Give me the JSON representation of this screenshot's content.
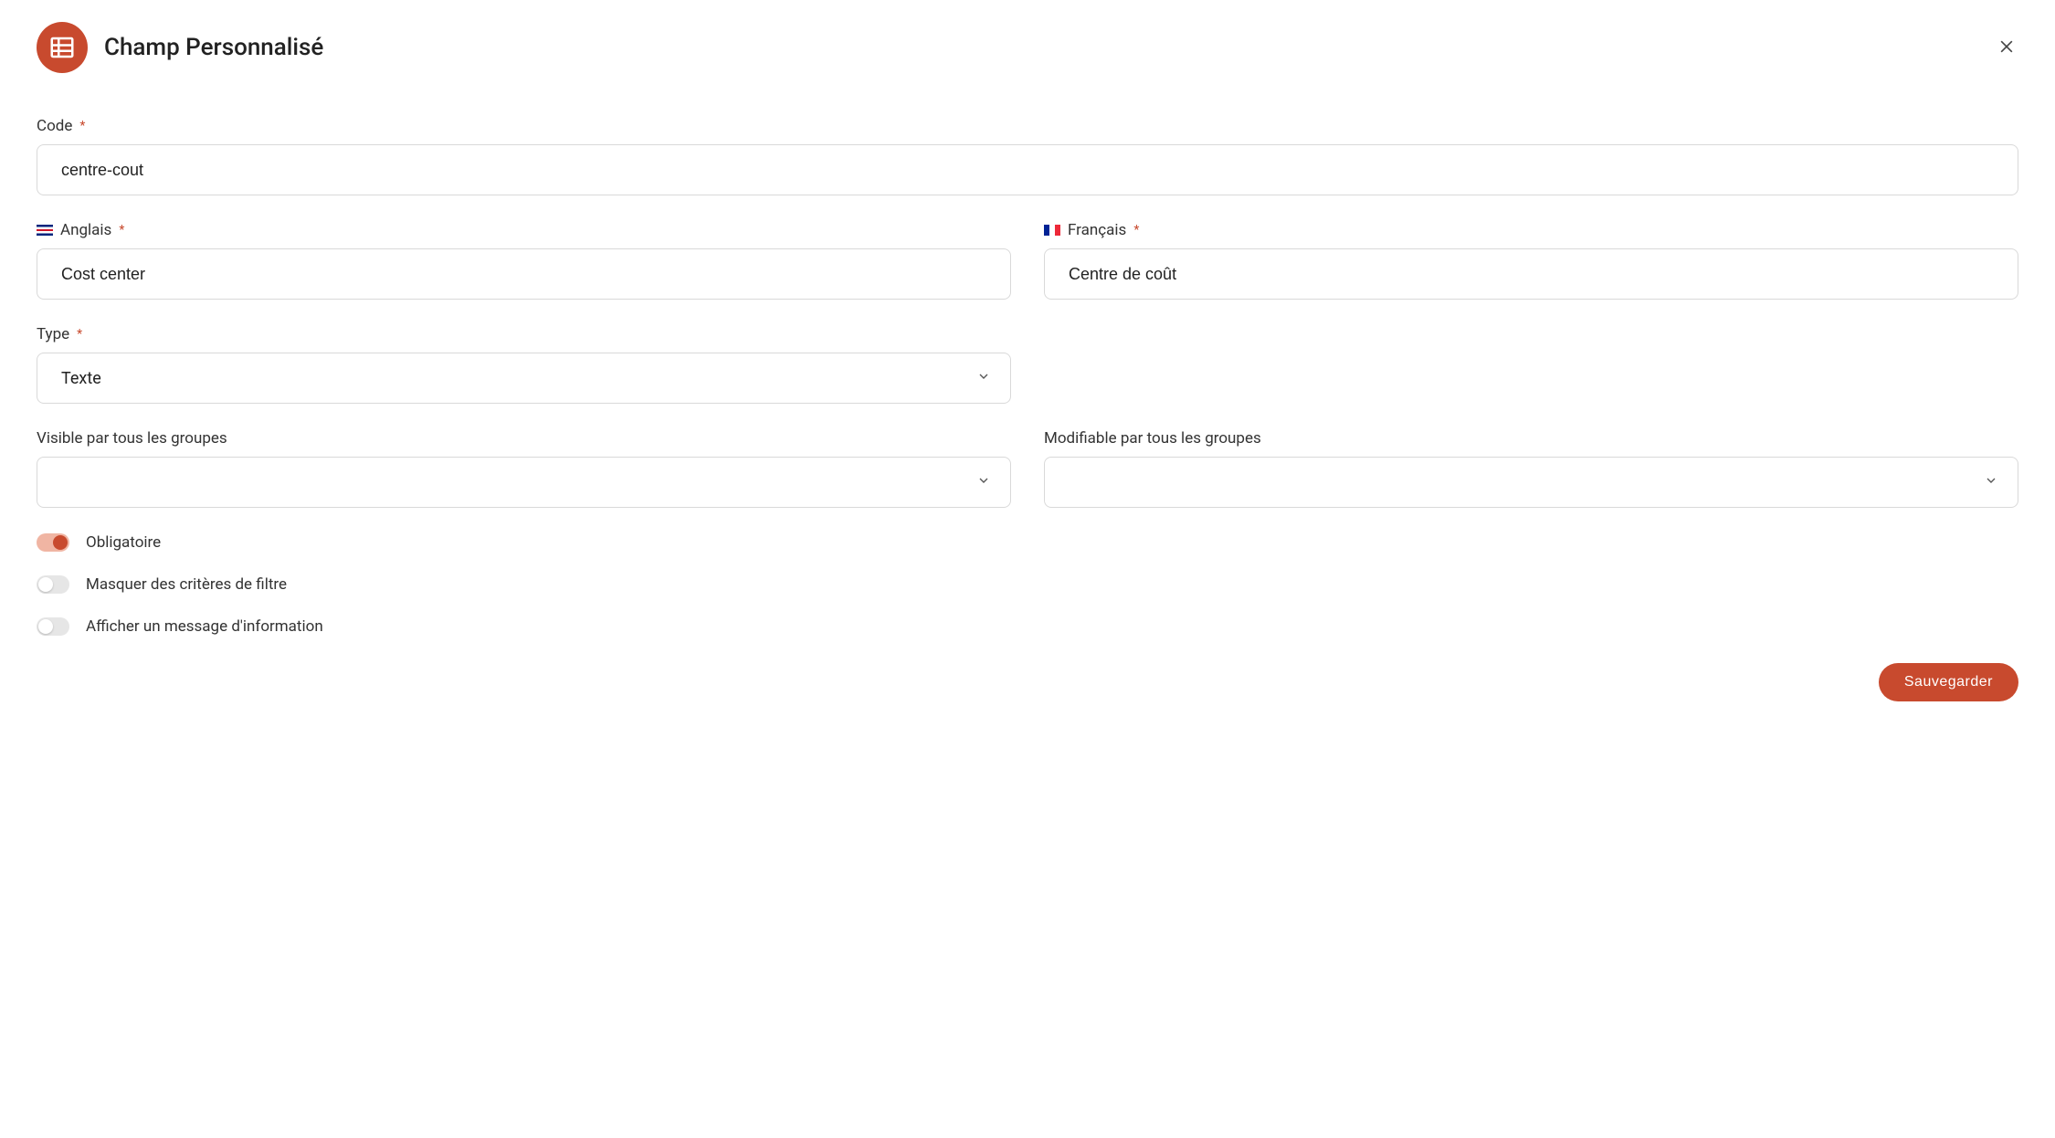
{
  "header": {
    "title": "Champ Personnalisé"
  },
  "form": {
    "code": {
      "label": "Code",
      "value": "centre-cout"
    },
    "english": {
      "label": "Anglais",
      "value": "Cost center"
    },
    "french": {
      "label": "Français",
      "value": "Centre de coût"
    },
    "type": {
      "label": "Type",
      "value": "Texte"
    },
    "visible_groups": {
      "label": "Visible par tous les groupes",
      "value": ""
    },
    "editable_groups": {
      "label": "Modifiable par tous les groupes",
      "value": ""
    },
    "mandatory": {
      "label": "Obligatoire",
      "on": true
    },
    "hide_filter": {
      "label": "Masquer des critères de filtre",
      "on": false
    },
    "show_info": {
      "label": "Afficher un message d'information",
      "on": false
    }
  },
  "footer": {
    "save_label": "Sauvegarder"
  }
}
